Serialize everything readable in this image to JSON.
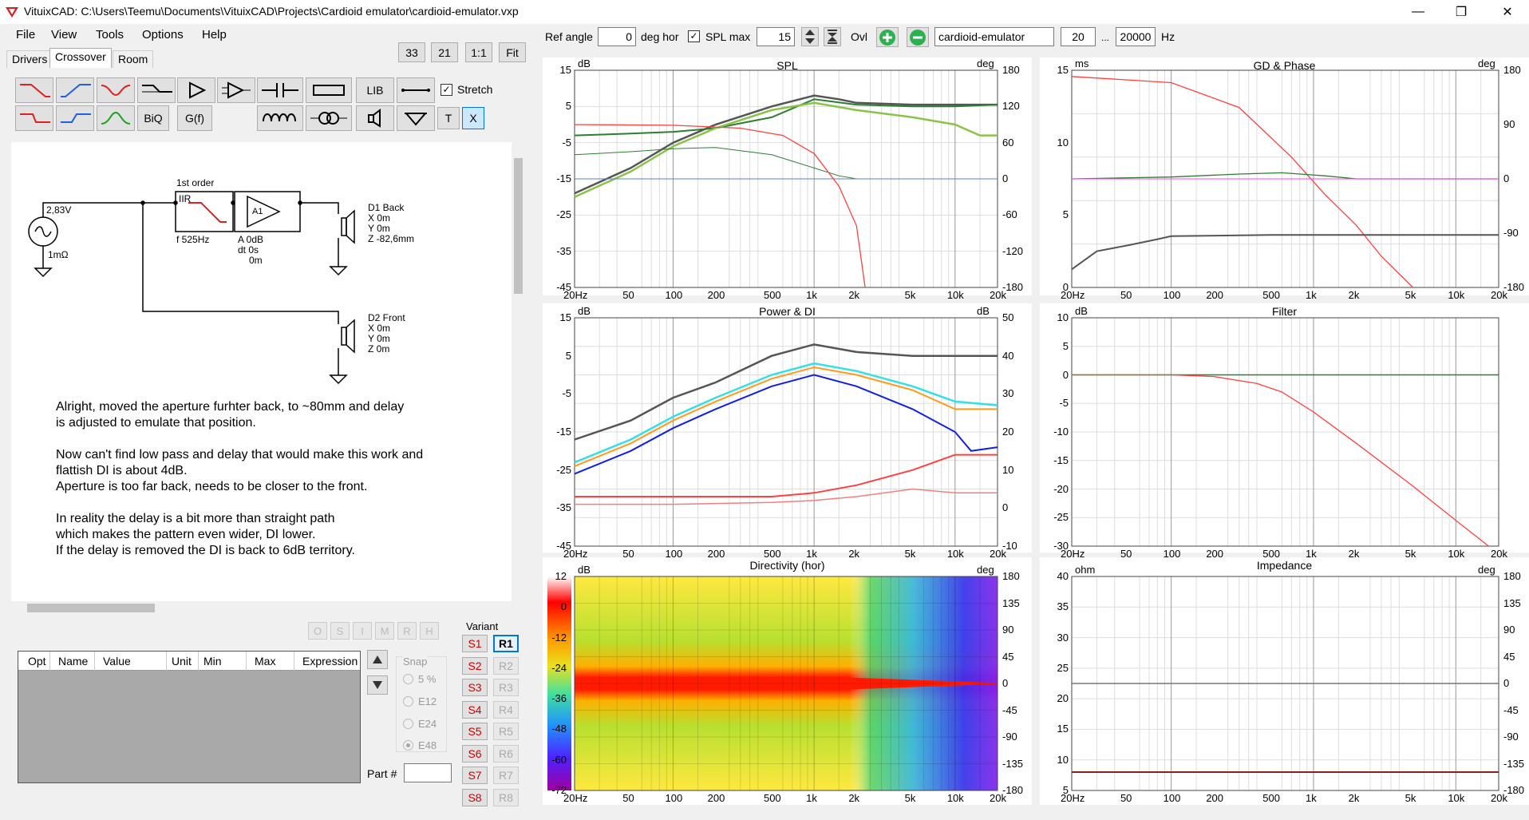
{
  "window": {
    "title": "VituixCAD: C:\\Users\\Teemu\\Documents\\VituixCAD\\Projects\\Cardioid emulator\\cardioid-emulator.vxp",
    "minimize": "—",
    "maximize": "❐",
    "close": "✕"
  },
  "menu": [
    "File",
    "View",
    "Tools",
    "Options",
    "Help"
  ],
  "tabs": [
    "Drivers",
    "Crossover",
    "Room"
  ],
  "toolbar": {
    "n33": "33",
    "n21": "21",
    "ratio": "1:1",
    "fit": "Fit",
    "lib": "LIB",
    "biq": "BiQ",
    "gf": "G(f)",
    "t": "T",
    "x": "X",
    "stretch": "Stretch"
  },
  "topbar": {
    "ref_angle_label": "Ref angle",
    "ref_angle": "0",
    "deg_hor": "deg hor",
    "spl_max_label": "SPL max",
    "spl_max": "15",
    "ovl": "Ovl",
    "name": "cardioid-emulator",
    "f_lo": "20",
    "dots": "...",
    "f_hi": "20000",
    "hz": "Hz"
  },
  "schematic": {
    "source_v": "2,83V",
    "source_r": "1mΩ",
    "filter_title": "1st order",
    "filter_type": "IIR",
    "filter_f": "f   525Hz",
    "amp_label": "A1",
    "amp_a": "A  0dB",
    "amp_dt": "dt 0s",
    "amp_m": "0m",
    "d1": [
      "D1 Back",
      "X 0m",
      "Y 0m",
      "Z -82,6mm"
    ],
    "d2": [
      "D2 Front",
      "X 0m",
      "Y 0m",
      "Z 0m"
    ],
    "notes": [
      "Alright, moved the aperture furhter back, to ~80mm and delay",
      "is adjusted to emulate that position.",
      "",
      "Now can't find low pass and delay that would make this work and",
      "flattish DI is about 4dB.",
      "Aperture is too far back, needs to be closer to the front.",
      "",
      "In reality the delay is a bit more than straight path",
      "which makes the pattern even wider, DI lower.",
      "If the delay is removed the DI is  back to 6dB territory."
    ]
  },
  "opt_buttons": [
    "O",
    "S",
    "I",
    "M",
    "R",
    "H"
  ],
  "param_table": {
    "headers": [
      "Opt",
      "Name",
      "Value",
      "Unit",
      "Min",
      "Max",
      "Expression"
    ]
  },
  "snap": {
    "label": "Snap",
    "options": [
      "5 %",
      "E12",
      "E24",
      "E48"
    ],
    "selected": "E48"
  },
  "part_label": "Part #",
  "variant": {
    "label": "Variant",
    "s": [
      "S1",
      "S2",
      "S3",
      "S4",
      "S5",
      "S6",
      "S7",
      "S8"
    ],
    "r": [
      "R1",
      "R2",
      "R3",
      "R4",
      "R5",
      "R6",
      "R7",
      "R8"
    ],
    "selected": "R1"
  },
  "freq_ticks": [
    "20Hz",
    "50",
    "100",
    "200",
    "500",
    "1k",
    "2k",
    "5k",
    "10k",
    "20k"
  ],
  "panels": {
    "spl": {
      "title": "SPL",
      "left_unit": "dB",
      "right_unit": "deg",
      "left": [
        "15",
        "5",
        "-5",
        "-15",
        "-25",
        "-35",
        "-45"
      ],
      "right": [
        "180",
        "120",
        "60",
        "0",
        "-60",
        "-120",
        "-180"
      ]
    },
    "gd": {
      "title": "GD & Phase",
      "left_unit": "ms",
      "right_unit": "deg",
      "left": [
        "15",
        "10",
        "5",
        "0"
      ],
      "right": [
        "180",
        "90",
        "0",
        "-90",
        "-180"
      ]
    },
    "pdi": {
      "title": "Power & DI",
      "left_unit": "dB",
      "right_unit": "dB",
      "left": [
        "15",
        "5",
        "-5",
        "-15",
        "-25",
        "-35",
        "-45"
      ],
      "right": [
        "50",
        "40",
        "30",
        "20",
        "10",
        "0",
        "-10"
      ]
    },
    "filter": {
      "title": "Filter",
      "left_unit": "dB",
      "left": [
        "10",
        "5",
        "0",
        "-5",
        "-10",
        "-15",
        "-20",
        "-25",
        "-30"
      ]
    },
    "dir": {
      "title": "Directivity (hor)",
      "left_unit": "dB",
      "right_unit": "deg",
      "scale": [
        "12",
        "0",
        "-12",
        "-24",
        "-36",
        "-48",
        "-60",
        "-72"
      ],
      "right": [
        "180",
        "135",
        "90",
        "45",
        "0",
        "-45",
        "-90",
        "-135",
        "-180"
      ]
    },
    "imp": {
      "title": "Impedance",
      "left_unit": "ohm",
      "right_unit": "deg",
      "left": [
        "40",
        "35",
        "30",
        "25",
        "20",
        "15",
        "10",
        "5"
      ],
      "right": [
        "180",
        "135",
        "90",
        "45",
        "0",
        "-45",
        "-90",
        "-135",
        "-180"
      ]
    }
  },
  "colors": {
    "spl_gray": "#555555",
    "spl_green": "#2e7d32",
    "spl_lime": "#8bc34a",
    "red": "#ff4040",
    "cyan": "#33e0e8",
    "orange": "#ff9a1f",
    "blue": "#1020e0",
    "imp": "#8b2020"
  }
}
